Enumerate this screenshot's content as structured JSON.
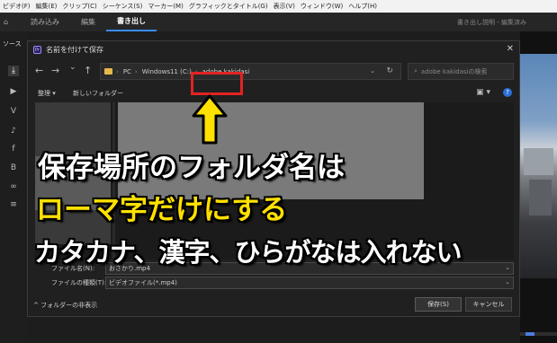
{
  "menubar": [
    "ビデオ(F)",
    "編集(E)",
    "クリップ(C)",
    "シーケンス(S)",
    "マーカー(M)",
    "グラフィックとタイトル(G)",
    "表示(V)",
    "ウィンドウ(W)",
    "ヘルプ(H)"
  ],
  "workspace": {
    "tabs": [
      "読み込み",
      "編集",
      "書き出し"
    ],
    "active": "書き出し",
    "right": "書き出し説明 - 編集済み"
  },
  "sidebar": {
    "source_label": "ソース"
  },
  "dialog": {
    "title": "名前を付けて保存",
    "close": "✕",
    "nav": {
      "back": "←",
      "forward": "→",
      "dropdown": "⌄",
      "up": "↑"
    },
    "address": {
      "seg1": "PC",
      "seg2": "Windows11 (C:)",
      "seg3": "adobe kakidasi",
      "sep": "›"
    },
    "search": {
      "placeholder": "adobe kakidasiの検索"
    },
    "toolbar": {
      "organize": "整理 ▾",
      "new_folder": "新しいフォルダー"
    },
    "filename": {
      "label": "ファイル名(N):",
      "value": "おさかり.mp4"
    },
    "filetype": {
      "label": "ファイルの種類(T):",
      "value": "ビデオファイル(*.mp4)"
    },
    "footer": {
      "hide_folders": "フォルダーの非表示",
      "save": "保存(S)",
      "cancel": "キャンセル"
    }
  },
  "annotation": {
    "line1": "保存場所のフォルダ名は",
    "line2": "ローマ字だけにする",
    "line3": "カタカナ、漢字、ひらがなは入れない",
    "highlight_color": "#e32323",
    "accent_color": "#ffe100"
  }
}
